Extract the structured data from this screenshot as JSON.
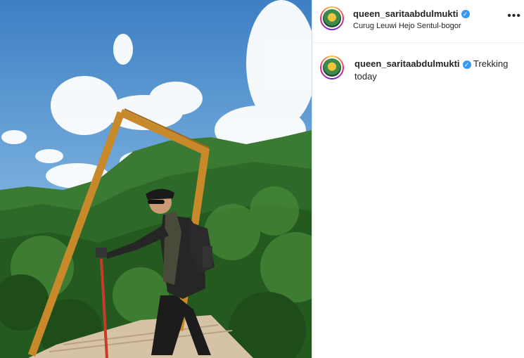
{
  "post": {
    "username": "queen_saritaabdulmukti",
    "verified": true,
    "location": "Curug Leuwi Hejo Sentul-bogor",
    "more_icon": "more-horizontal-icon",
    "caption": {
      "username": "queen_saritaabdulmukti",
      "text": "Trekking today"
    }
  },
  "photo": {
    "subject": "hiker standing in wooden frame on viewing deck overlooking forested mountains"
  },
  "colors": {
    "sky": "#6ca6d8",
    "forest": "#2f6b2a",
    "frame": "#c8892a",
    "verified": "#3897f0"
  }
}
